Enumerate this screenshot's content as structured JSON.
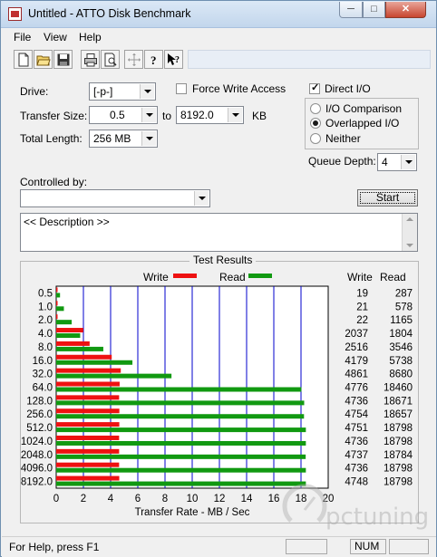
{
  "window": {
    "title": "Untitled - ATTO Disk Benchmark",
    "min_glyph": "─",
    "max_glyph": "□",
    "close_glyph": "✕"
  },
  "menu": {
    "file": "File",
    "view": "View",
    "help": "Help"
  },
  "toolbar": {
    "icons": [
      "new-file-icon",
      "open-folder-icon",
      "save-icon",
      "print-icon",
      "print-preview-icon",
      "move-icon",
      "help-icon",
      "context-help-icon"
    ]
  },
  "settings": {
    "drive_label": "Drive:",
    "drive_value": "[-p-]",
    "force_write_label": "Force Write Access",
    "force_write_checked": false,
    "direct_io_label": "Direct I/O",
    "direct_io_checked": true,
    "transfer_size_label": "Transfer Size:",
    "transfer_from": "0.5",
    "to_label": "to",
    "transfer_to": "8192.0",
    "kb_label": "KB",
    "total_length_label": "Total Length:",
    "total_length_value": "256 MB",
    "io_options": [
      {
        "label": "I/O Comparison",
        "selected": false
      },
      {
        "label": "Overlapped I/O",
        "selected": true
      },
      {
        "label": "Neither",
        "selected": false
      }
    ],
    "queue_depth_label": "Queue Depth:",
    "queue_depth_value": "4",
    "controlled_by_label": "Controlled by:",
    "controlled_by_value": "",
    "start_label": "Start",
    "description_text": "<< Description >>"
  },
  "results": {
    "title": "Test Results",
    "write_legend": "Write",
    "read_legend": "Read",
    "write_col": "Write",
    "read_col": "Read",
    "write_color": "#ee1111",
    "read_color": "#119911"
  },
  "chart_data": {
    "type": "bar",
    "orientation": "horizontal",
    "xlabel": "Transfer Rate - MB / Sec",
    "xlim": [
      0,
      20
    ],
    "xticks": [
      "0",
      "2",
      "4",
      "6",
      "8",
      "10",
      "12",
      "14",
      "16",
      "18",
      "20"
    ],
    "grid": "vertical",
    "categories": [
      "0.5",
      "1.0",
      "2.0",
      "4.0",
      "8.0",
      "16.0",
      "32.0",
      "64.0",
      "128.0",
      "256.0",
      "512.0",
      "1024.0",
      "2048.0",
      "4096.0",
      "8192.0"
    ],
    "series": [
      {
        "name": "Write",
        "values": [
          19,
          21,
          22,
          2037,
          2516,
          4179,
          4861,
          4776,
          4736,
          4754,
          4751,
          4736,
          4737,
          4736,
          4748
        ]
      },
      {
        "name": "Read",
        "values": [
          287,
          578,
          1165,
          1804,
          3546,
          5738,
          8680,
          18460,
          18671,
          18657,
          18798,
          18798,
          18784,
          18798,
          18798
        ]
      }
    ],
    "value_units": "KB/s"
  },
  "statusbar": {
    "text": "For Help, press F1",
    "num": "NUM"
  },
  "watermark": {
    "text": "pctuning"
  }
}
